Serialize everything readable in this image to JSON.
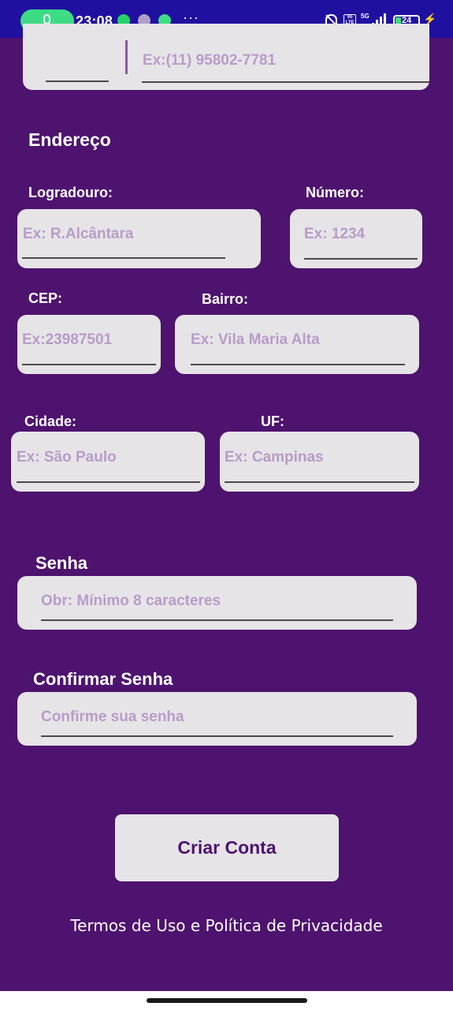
{
  "status_bar": {
    "time": "23:08",
    "dots": "···",
    "network": "5G",
    "battery": "24",
    "colors": {
      "bar": "#2010a0",
      "mic_pill": "#3ddc84"
    },
    "icons": [
      "mic-icon",
      "whatsapp-icon",
      "avatar-icon",
      "app-icon",
      "bell-off-icon",
      "volte-icon",
      "signal-icon",
      "battery-icon",
      "charging-icon"
    ]
  },
  "phone": {
    "placeholder": "Ex:(11) 95802-7781"
  },
  "address": {
    "section_title": "Endereço",
    "street": {
      "label": "Logradouro:",
      "placeholder": "Ex: R.Alcântara"
    },
    "number": {
      "label": "Número:",
      "placeholder": "Ex: 1234"
    },
    "cep": {
      "label": "CEP:",
      "placeholder": "Ex:23987501"
    },
    "district": {
      "label": "Bairro:",
      "placeholder": "Ex: Vila Maria Alta"
    },
    "city": {
      "label": "Cidade:",
      "placeholder": "Ex: São Paulo"
    },
    "state": {
      "label": "UF:",
      "placeholder": "Ex: Campinas"
    }
  },
  "password": {
    "label": "Senha",
    "placeholder": "Obr: Mínimo 8 caracteres"
  },
  "confirm_password": {
    "label": "Confirmar Senha",
    "placeholder": "Confirme sua senha"
  },
  "submit": {
    "label": "Criar Conta"
  },
  "terms": {
    "text": "Termos de Uso e Política de Privacidade"
  },
  "theme": {
    "background": "#4e136e",
    "field_bg": "#e6e4e7",
    "placeholder_color": "#b79cc8",
    "button_text": "#4e136e"
  }
}
